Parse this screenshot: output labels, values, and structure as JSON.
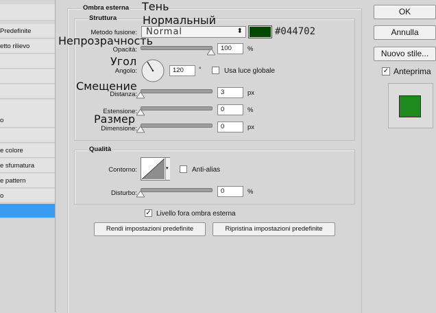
{
  "left_list": {
    "items": [
      "Predefinite",
      "etto rilievo",
      "",
      "",
      "",
      "",
      "o",
      "",
      "e colore",
      "e sfumatura",
      "e pattern",
      "o",
      ""
    ]
  },
  "section": {
    "title": "Ombra esterna",
    "overlay_shadow": "Тень"
  },
  "structure": {
    "title": "Struttura",
    "blend_label": "Metodo fusione:",
    "blend_value": "Normal",
    "color_hex": "#044702",
    "color_label": "#044702",
    "overlay_normal": "Нормальный",
    "opacity_label": "Opacità:",
    "opacity_value": "100",
    "opacity_unit": "%",
    "overlay_opacity": "Непрозрачность",
    "angle_label": "Angolo:",
    "angle_value": "120",
    "angle_unit": "°",
    "overlay_angle": "Угол",
    "global_light_label": "Usa luce globale",
    "global_light_checked": false,
    "distance_label": "Distanza:",
    "distance_value": "3",
    "distance_unit": "px",
    "overlay_distance": "Смещение",
    "spread_label": "Estensione:",
    "spread_value": "0",
    "spread_unit": "%",
    "size_label": "Dimensione:",
    "size_value": "0",
    "size_unit": "px",
    "overlay_size": "Размер",
    "opacity_level": 1.0,
    "distance_level": 0.0,
    "spread_level": 0.0,
    "size_level": 0.0
  },
  "quality": {
    "title": "Qualità",
    "contour_label": "Contorno:",
    "antialias_label": "Anti-alias",
    "antialias_checked": false,
    "noise_label": "Disturbo:",
    "noise_value": "0",
    "noise_unit": "%",
    "noise_level": 0.0
  },
  "knockout": {
    "label": "Livello fora ombra esterna",
    "checked": true,
    "checkmark": "✓"
  },
  "buttons": {
    "make_default": "Rendi impostazioni predefinite",
    "reset_default": "Ripristina impostazioni predefinite",
    "ok": "OK",
    "cancel": "Annulla",
    "new_style": "Nuovo stile...",
    "preview_label": "Anteprima",
    "preview_checked": true
  },
  "colors": {
    "shadow_color": "#044702",
    "preview_swatch": "#1e8a1e",
    "selected_row": "#3a9cf0"
  }
}
